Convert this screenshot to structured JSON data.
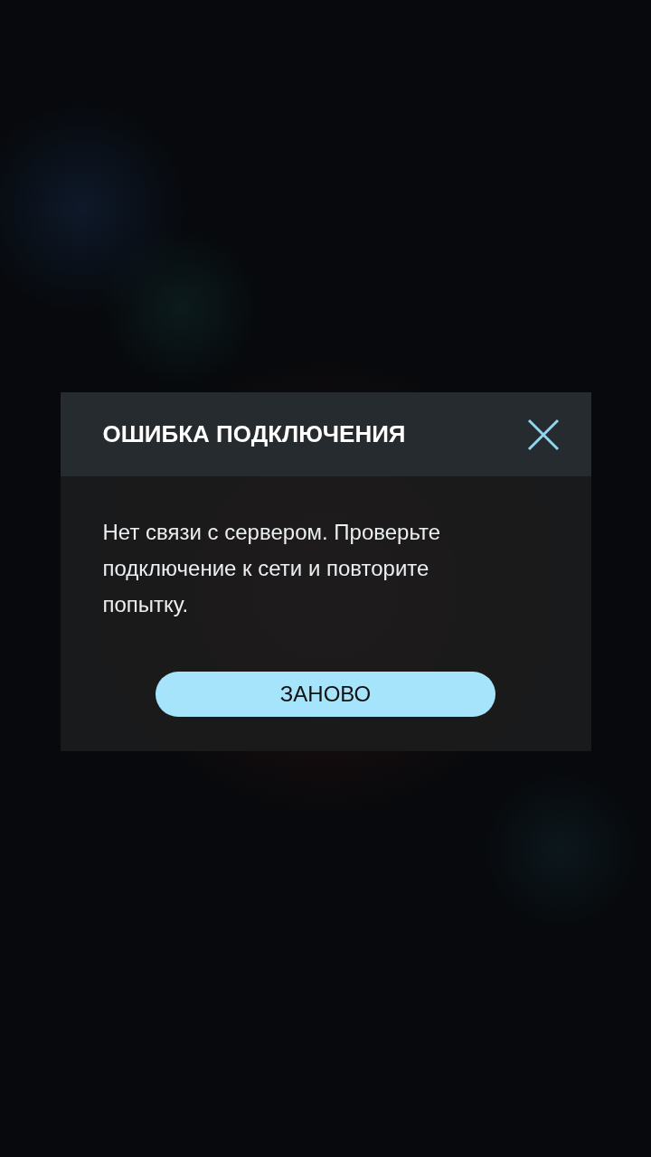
{
  "dialog": {
    "title": "ОШИБКА ПОДКЛЮЧЕНИЯ",
    "message": "Нет связи с сервером. Проверьте подключение к сети и повторите попытку.",
    "buttons": [
      {
        "label": "ЗАНОВО"
      }
    ]
  }
}
